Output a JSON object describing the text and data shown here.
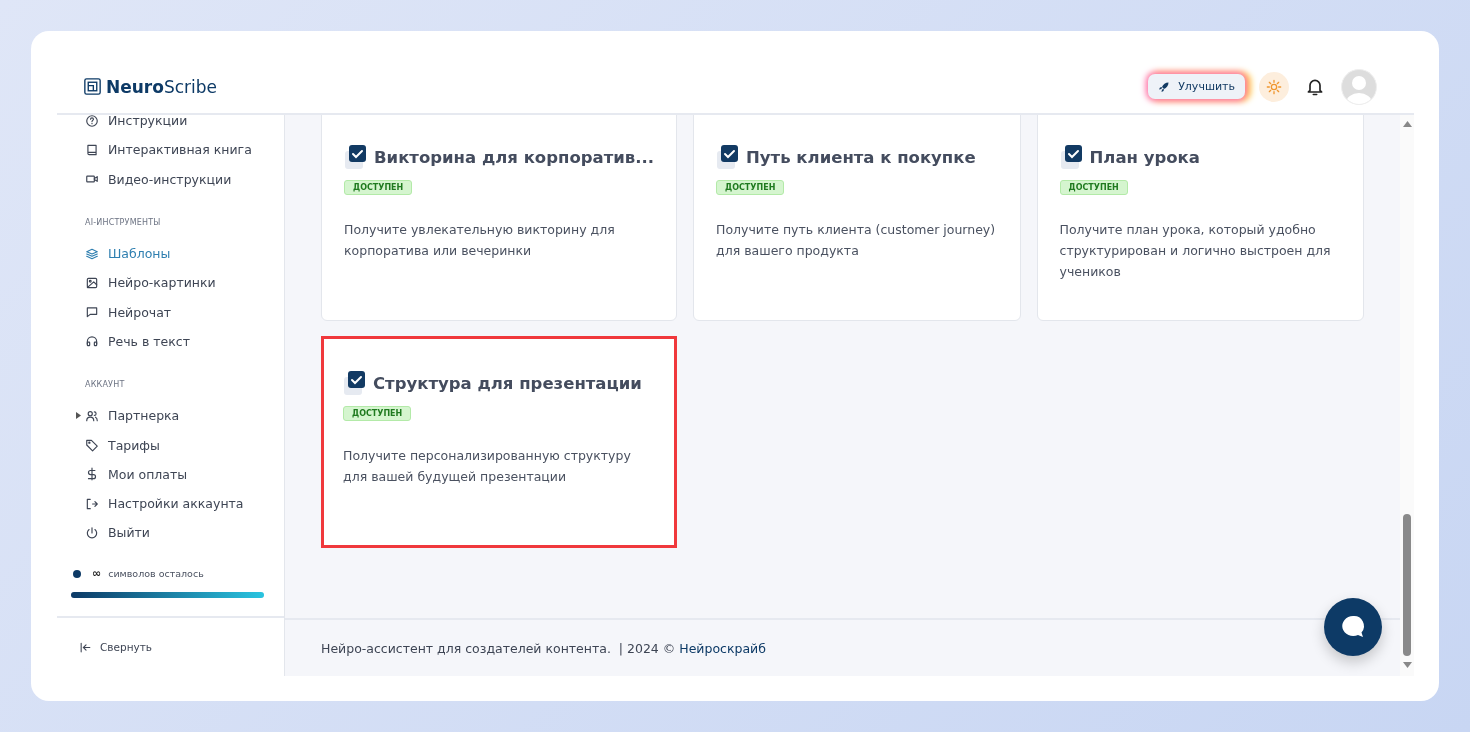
{
  "logo": "**Neuro**Scribe",
  "header": {
    "upgrade_button": "Улучшить"
  },
  "sidebar": {
    "sections": [
      {
        "items": [
          {
            "label": "Инструкции",
            "selected": false,
            "kind": "link"
          },
          {
            "label": "Интерактивная книга",
            "selected": false,
            "kind": "link"
          },
          {
            "label": "Видео-инструкции",
            "selected": false,
            "kind": "link"
          }
        ]
      },
      {
        "title": "AI-ИНСТРУМЕНТЫ",
        "items": [
          {
            "label": "Шаблоны",
            "selected": true,
            "kind": "link"
          },
          {
            "label": "Нейро-картинки",
            "selected": false,
            "kind": "link"
          },
          {
            "label": "Нейрочат",
            "selected": false,
            "kind": "link"
          },
          {
            "label": "Речь в текст",
            "selected": false,
            "kind": "link"
          }
        ]
      },
      {
        "title": "АККАУНТ",
        "items": [
          {
            "label": "Партнерка",
            "selected": false,
            "kind": "group"
          },
          {
            "label": "Тарифы",
            "selected": false,
            "kind": "link"
          },
          {
            "label": "Мои оплаты",
            "selected": false,
            "kind": "link"
          },
          {
            "label": "Настройки аккаунта",
            "selected": false,
            "kind": "link"
          },
          {
            "label": "Выйти",
            "selected": false,
            "kind": "link"
          }
        ]
      }
    ],
    "credits": {
      "amount": "∞",
      "label": "символов осталось",
      "level": 1
    },
    "collapse": "Свернуть"
  },
  "cards": [
    {
      "title": "Викторина для корпоратив...",
      "badge": "ДОСТУПЕН",
      "description": "Получите увлекательную викторину для корпоратива или вечеринки",
      "highlighted": false
    },
    {
      "title": "Путь клиента к покупке",
      "badge": "ДОСТУПЕН",
      "description": "Получите путь клиента (customer journey) для вашего продукта",
      "highlighted": false
    },
    {
      "title": "План урока",
      "badge": "ДОСТУПЕН",
      "description": "Получите план урока, который удобно структурирован и логично выстроен для учеников",
      "highlighted": false
    },
    {
      "title": "Структура для презентации",
      "badge": "ДОСТУПЕН",
      "description": "Получите персонализированную структуру для вашей будущей презентации",
      "highlighted": true
    }
  ],
  "footer": {
    "text": "Нейро-ассистент для создателей контента.  | 2024 ©",
    "link": "Нейроскрайб"
  }
}
